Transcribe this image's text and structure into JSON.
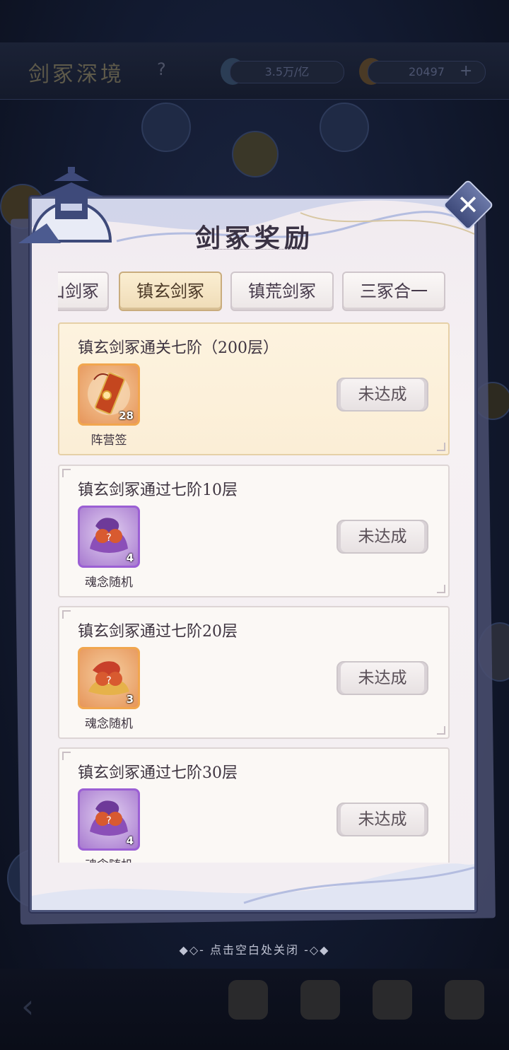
{
  "background": {
    "title": "剑冢深境",
    "help_mark": "?",
    "resource_1": "3.5万/亿",
    "resource_2": "20497",
    "plus_label": "+"
  },
  "panel": {
    "title": "剑冢奖励",
    "close_label": "✕",
    "tabs": [
      {
        "label": "山剑冢",
        "active": false
      },
      {
        "label": "镇玄剑冢",
        "active": true
      },
      {
        "label": "镇荒剑冢",
        "active": false
      },
      {
        "label": "三冢合一",
        "active": false
      }
    ],
    "rewards": [
      {
        "title": "镇玄剑冢通关七阶（200层）",
        "item_name": "阵营签",
        "count": "28",
        "rarity": "gold",
        "status": "未达成",
        "highlight": true
      },
      {
        "title": "镇玄剑冢通过七阶10层",
        "item_name": "魂念随机",
        "count": "4",
        "rarity": "purple",
        "status": "未达成",
        "highlight": false
      },
      {
        "title": "镇玄剑冢通过七阶20层",
        "item_name": "魂念随机",
        "count": "3",
        "rarity": "gold",
        "status": "未达成",
        "highlight": false
      },
      {
        "title": "镇玄剑冢通过七阶30层",
        "item_name": "魂念随机",
        "count": "4",
        "rarity": "purple",
        "status": "未达成",
        "highlight": false
      }
    ]
  },
  "close_hint": "◆◇- 点击空白处关闭 -◇◆",
  "colors": {
    "panel_border": "#4c5479",
    "active_tab": "#efdcb7",
    "gold_item": "#f1a64e",
    "purple_item": "#9b5fd4"
  }
}
